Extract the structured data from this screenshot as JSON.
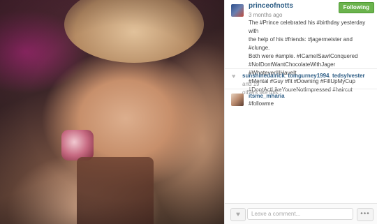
{
  "post": {
    "username": "princeofnotts",
    "timestamp": "3 months ago",
    "follow_label": "Following",
    "caption_lines": [
      "The #Prince celebrated his #birthday yesterday with",
      "the help of his #friends: #jagermeister and #clunge.",
      "Both were #ample. #ICameISawIConquered",
      "#NoIDontWantChocolateWithJager #WhateverIIIHaveIt",
      "#Mental #Guy #fit #Downing #FillUpMyCup",
      "#DontActLikeYoureNotImpressed #haircut"
    ]
  },
  "likes": {
    "users": [
      "sunshinedalrick",
      "tomgurney1994",
      "tedsylvester"
    ],
    "sep1": ", ",
    "sep2": ", ",
    "suffix_line1": " and 19",
    "suffix_line2": "others like this."
  },
  "comment": {
    "username": "itsme_mharia",
    "text": "#followme"
  },
  "footer": {
    "comment_placeholder": "Leave a comment...",
    "more_label": "•••"
  },
  "colors": {
    "link": "#2e5e86",
    "follow_green": "#6bb34d"
  },
  "icons": {
    "heart": "heart-icon",
    "more": "ellipsis-icon"
  }
}
